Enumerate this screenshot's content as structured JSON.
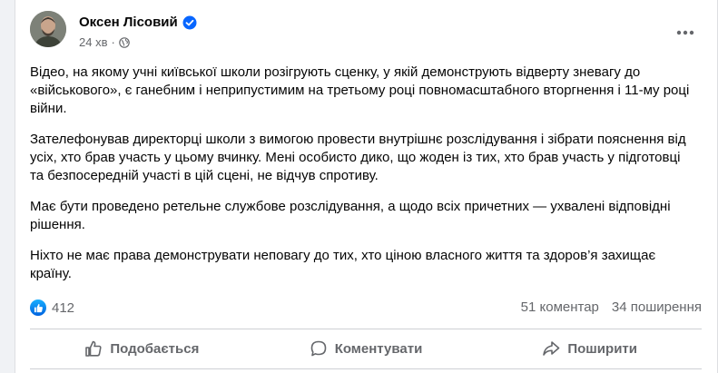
{
  "post": {
    "author": "Оксен Лісовий",
    "time": "24 хв",
    "paragraphs": [
      "Відео, на якому учні київської школи розігрують сценку, у якій демонструють відверту зневагу до «військового», є ганебним і неприпустимим на третьому році повномасштабного вторгнення і 11-му році війни.",
      "Зателефонував директорці школи з вимогою провести внутрішнє розслідування і зібрати пояснення від усіх, хто брав участь у цьому вчинку. Мені особисто дико, що жоден із тих, хто брав участь у підготовці та безпосередній участі в цій сцені, не відчув спротиву.",
      "Має бути проведено ретельне службове розслідування, а щодо всіх причетних —  ухвалені відповідні рішення.",
      "Ніхто не має права демонструвати неповагу до тих, хто ціною власного життя та здоров’я захищає країну."
    ],
    "icons": {
      "verified": "verified-badge-icon",
      "privacy": "globe-icon",
      "more": "more-options-icon"
    }
  },
  "stats": {
    "reactions_count": "412",
    "comments": "51 коментар",
    "shares": "34 поширення"
  },
  "actions": {
    "like": "Подобається",
    "comment": "Коментувати",
    "share": "Поширити"
  },
  "colors": {
    "accent": "#0866ff",
    "secondary_text": "#65676b",
    "background": "#f0f2f5"
  }
}
